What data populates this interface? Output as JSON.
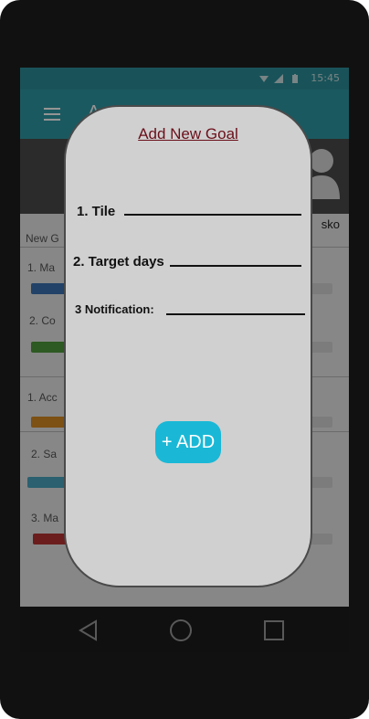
{
  "status_bar": {
    "time": "15:45"
  },
  "app_bar": {
    "title": "A..."
  },
  "background": {
    "side_name": "sko",
    "tab_label": "New G",
    "items": [
      {
        "label": "1. Ma",
        "bar_color": "#3b72b4"
      },
      {
        "label": "2. Co",
        "bar_color": "#4f9a3c"
      },
      {
        "label": "1. Acc",
        "bar_color": "#d88a22"
      },
      {
        "label": "2. Sa",
        "bar_color": "#49a6c0"
      },
      {
        "label": "3. Ma",
        "bar_color": "#b83232"
      }
    ]
  },
  "dialog": {
    "title": "Add New Goal",
    "fields": [
      {
        "label": "1. Tile"
      },
      {
        "label": "2. Target days"
      },
      {
        "label": "3 Notification:"
      }
    ],
    "add_button": "+ ADD"
  },
  "colors": {
    "accent": "#1ab8d6",
    "app_bar": "#2f9aa6",
    "dialog_bg": "#d0d0d0",
    "title_text": "#6b0f1a"
  }
}
